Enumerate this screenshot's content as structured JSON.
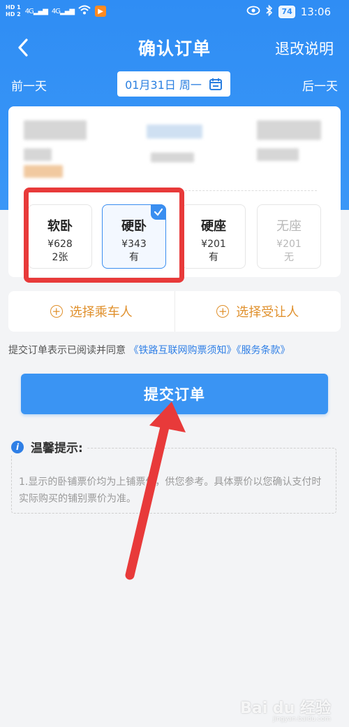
{
  "status_bar": {
    "hd1": "HD 1",
    "hd2": "HD 2",
    "signal1": "4G",
    "signal2": "4G",
    "battery": "74",
    "time": "13:06"
  },
  "nav": {
    "title": "确认订单",
    "right_link": "退改说明"
  },
  "date_bar": {
    "prev_day": "前一天",
    "date": "01月31日 周一",
    "next_day": "后一天"
  },
  "seats": [
    {
      "name": "软卧",
      "price": "¥628",
      "availability": "2张"
    },
    {
      "name": "硬卧",
      "price": "¥343",
      "availability": "有"
    },
    {
      "name": "硬座",
      "price": "¥201",
      "availability": "有"
    },
    {
      "name": "无座",
      "price": "¥201",
      "availability": "无"
    }
  ],
  "passenger": {
    "select_passenger": "选择乘车人",
    "select_beneficiary": "选择受让人"
  },
  "agreement": {
    "text": "提交订单表示已阅读并同意",
    "link1": "《铁路互联网购票须知》",
    "link2": "《服务条款》"
  },
  "submit": {
    "label": "提交订单"
  },
  "tip": {
    "title": "温馨提示:",
    "body": "1.显示的卧铺票价均为上铺票价，供您参考。具体票价以您确认支付时实际购买的铺别票价为准。"
  },
  "watermark": {
    "main": "Bai du 经验",
    "sub": "jingyan.baidu.com"
  },
  "colors": {
    "brand_blue": "#2f8df4",
    "accent_orange": "#e0902c",
    "highlight_red": "#e83a3a"
  }
}
